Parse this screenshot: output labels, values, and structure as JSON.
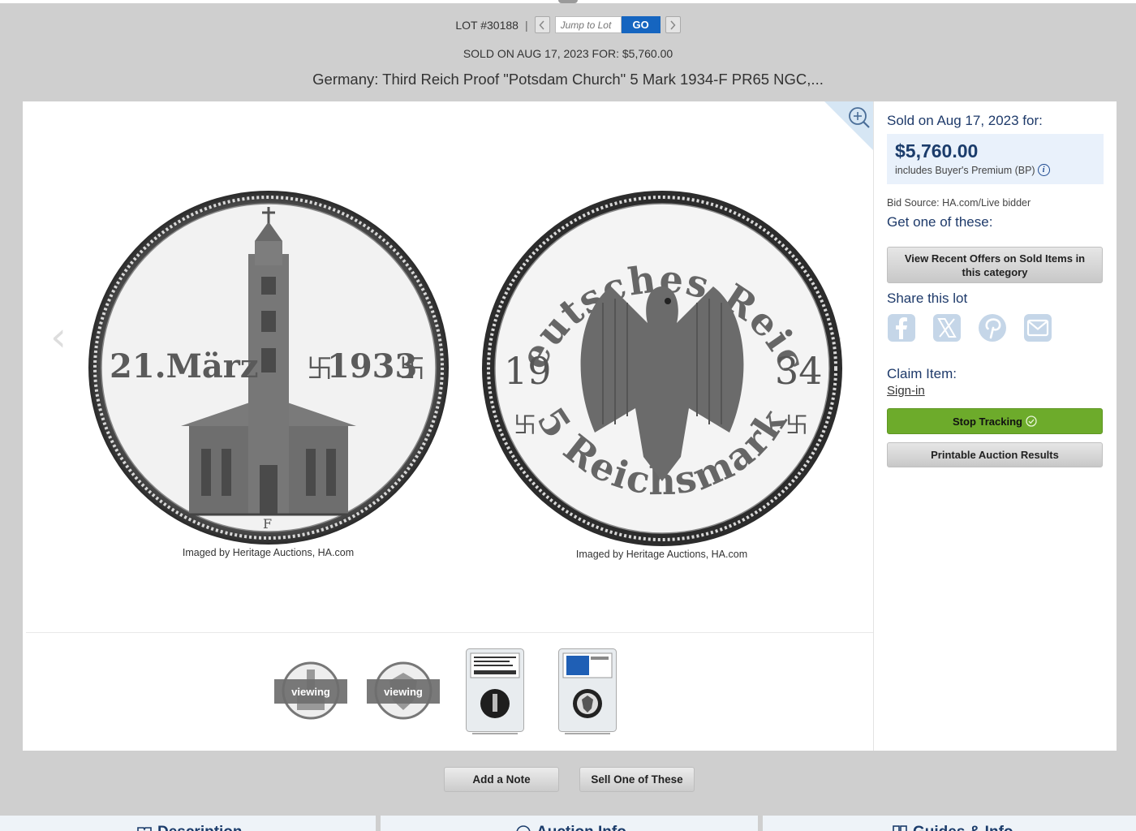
{
  "lot_nav": {
    "lot_label": "LOT #30188",
    "separator": "|",
    "prev_icon": "chevron-left-icon",
    "next_icon": "chevron-right-icon",
    "jump_placeholder": "Jump to Lot",
    "go_label": "GO"
  },
  "sold_line": "SOLD ON AUG 17, 2023 FOR: $5,760.00",
  "title": "Germany: Third Reich Proof \"Potsdam Church\" 5 Mark 1934-F PR65 NGC,...",
  "viewer": {
    "zoom_icon": "zoom-in-icon",
    "images": [
      {
        "name": "obverse",
        "caption": "Imaged by Heritage Auctions, HA.com",
        "legend": "21.März",
        "year": "1933",
        "mint": "F"
      },
      {
        "name": "reverse",
        "caption": "Imaged by Heritage Auctions, HA.com",
        "legend_top": "Deutsches Reich",
        "legend_bottom": "5 Reichsmark",
        "date_left": "19",
        "date_right": "34"
      }
    ],
    "thumbnails": [
      {
        "overlay": "viewing"
      },
      {
        "overlay": "viewing"
      },
      {
        "overlay": ""
      },
      {
        "overlay": ""
      }
    ]
  },
  "sidebar": {
    "sold_heading": "Sold on Aug 17, 2023 for:",
    "price": "$5,760.00",
    "premium_note": "includes Buyer's Premium (BP)",
    "bid_source": "Bid Source: HA.com/Live bidder",
    "get_one": "Get one of these:",
    "recent_offers_button": "View Recent Offers on Sold Items in this category",
    "share_heading": "Share this lot",
    "share_icons": [
      "facebook-icon",
      "x-icon",
      "pinterest-icon",
      "email-icon"
    ],
    "claim_heading": "Claim Item:",
    "sign_in": "Sign-in",
    "stop_tracking": "Stop Tracking",
    "printable": "Printable Auction Results"
  },
  "actions": {
    "add_note": "Add a Note",
    "sell_one": "Sell One of These"
  },
  "tabs": [
    "Description",
    "Auction Info",
    "Guides & Info"
  ],
  "colors": {
    "accent_blue": "#1565c0",
    "price_blue": "#1b3c6b",
    "track_green": "#6dab2b",
    "page_gray": "#cfcfcf"
  }
}
